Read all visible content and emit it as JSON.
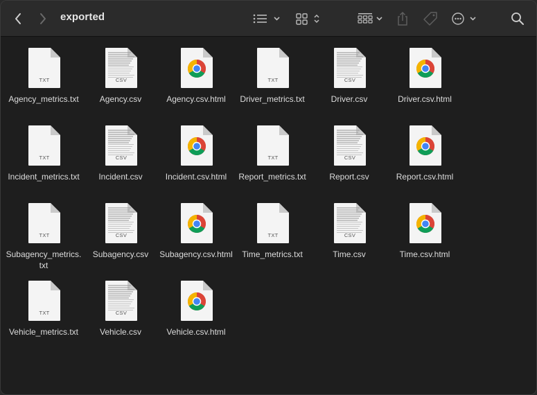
{
  "window": {
    "title": "exported"
  },
  "toolbar": {
    "back_icon": "chevron-left-icon",
    "forward_icon": "chevron-right-icon",
    "list_view_icon": "list-view-icon",
    "grid_view_icon": "icon-grid-icon",
    "group_icon": "group-by-icon",
    "share_icon": "share-icon",
    "tag_icon": "tag-icon",
    "more_icon": "more-actions-icon",
    "search_icon": "search-icon"
  },
  "icon_tags": {
    "txt": "TXT",
    "csv": "CSV"
  },
  "files": [
    {
      "name": "Agency_metrics.txt",
      "kind": "txt"
    },
    {
      "name": "Agency.csv",
      "kind": "csv"
    },
    {
      "name": "Agency.csv.html",
      "kind": "html"
    },
    {
      "name": "Driver_metrics.txt",
      "kind": "txt"
    },
    {
      "name": "Driver.csv",
      "kind": "csv"
    },
    {
      "name": "Driver.csv.html",
      "kind": "html"
    },
    {
      "name": "Incident_metrics.txt",
      "kind": "txt"
    },
    {
      "name": "Incident.csv",
      "kind": "csv"
    },
    {
      "name": "Incident.csv.html",
      "kind": "html"
    },
    {
      "name": "Report_metrics.txt",
      "kind": "txt"
    },
    {
      "name": "Report.csv",
      "kind": "csv"
    },
    {
      "name": "Report.csv.html",
      "kind": "html"
    },
    {
      "name": "Subagency_metrics.txt",
      "kind": "txt"
    },
    {
      "name": "Subagency.csv",
      "kind": "csv"
    },
    {
      "name": "Subagency.csv.html",
      "kind": "html"
    },
    {
      "name": "Time_metrics.txt",
      "kind": "txt"
    },
    {
      "name": "Time.csv",
      "kind": "csv"
    },
    {
      "name": "Time.csv.html",
      "kind": "html"
    },
    {
      "name": "Vehicle_metrics.txt",
      "kind": "txt"
    },
    {
      "name": "Vehicle.csv",
      "kind": "csv"
    },
    {
      "name": "Vehicle.csv.html",
      "kind": "html"
    }
  ]
}
